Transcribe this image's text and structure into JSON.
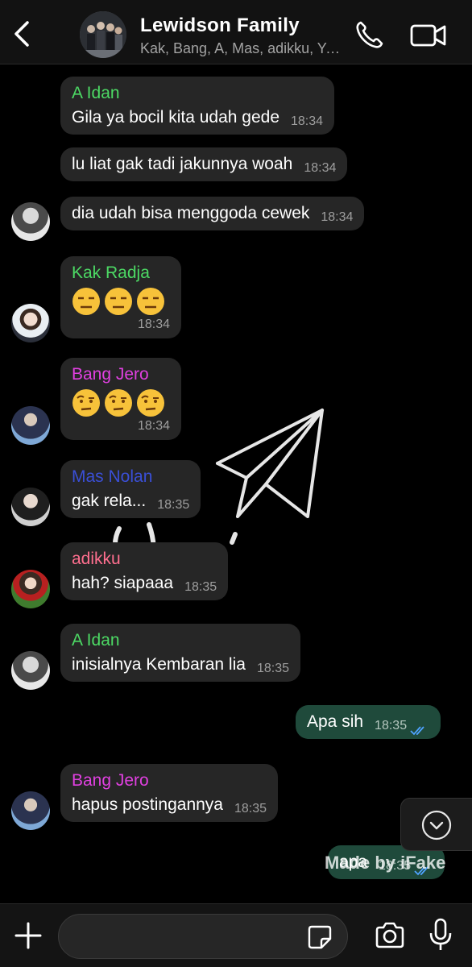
{
  "header": {
    "title": "Lewidson Family",
    "subtitle": "Kak, Bang, A, Mas, adikku, You",
    "back_icon": "chevron-left-icon",
    "call_icon": "phone-icon",
    "video_icon": "video-camera-icon"
  },
  "messages": [
    {
      "sender": "A Idan",
      "sender_color": "#4cd964",
      "text": "Gila ya bocil kita udah gede",
      "time": "18:34"
    },
    {
      "text": "lu liat gak tadi jakunnya woah",
      "time": "18:34"
    },
    {
      "text": "dia udah bisa menggoda cewek",
      "time": "18:34"
    },
    {
      "sender": "Kak Radja",
      "sender_color": "#4cd964",
      "emoji": "expressionless-face",
      "time": "18:34"
    },
    {
      "sender": "Bang Jero",
      "sender_color": "#e040e0",
      "emoji": "raised-eyebrow-face",
      "time": "18:34"
    },
    {
      "sender": "Mas Nolan",
      "sender_color": "#3a4fd6",
      "text": "gak rela...",
      "time": "18:35"
    },
    {
      "sender": "adikku",
      "sender_color": "#ff6f8f",
      "text": "hah? siapaaa",
      "time": "18:35"
    },
    {
      "sender": "A Idan",
      "sender_color": "#4cd964",
      "text": "inisialnya Kembaran lia",
      "time": "18:35"
    },
    {
      "outgoing": true,
      "text": "Apa sih",
      "time": "18:35",
      "status": "read"
    },
    {
      "sender": "Bang Jero",
      "sender_color": "#e040e0",
      "text": "hapus postingannya",
      "time": "18:35"
    },
    {
      "outgoing": true,
      "text": "apa",
      "time": "18:35",
      "status": "read"
    }
  ],
  "watermark": "Made by iFake",
  "composer": {
    "placeholder": "",
    "plus_icon": "plus-icon",
    "sticker_icon": "sticker-icon",
    "camera_icon": "camera-icon",
    "mic_icon": "microphone-icon"
  },
  "scroll_down_icon": "chevron-down-circle-icon",
  "colors": {
    "background": "#000000",
    "incoming_bubble": "#262626",
    "outgoing_bubble": "#1f4a3b",
    "read_check": "#4fa3ff"
  }
}
